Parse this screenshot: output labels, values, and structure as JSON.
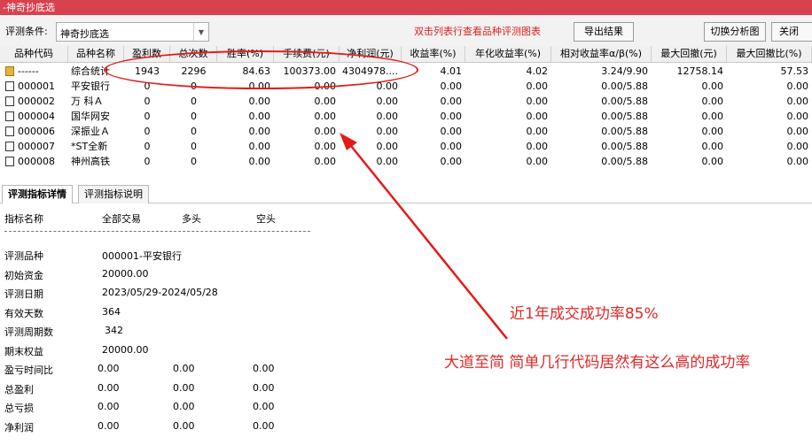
{
  "window": {
    "title": "-神奇抄底选"
  },
  "toolbar": {
    "condition_label": "评测条件:",
    "condition_value": "神奇抄底选",
    "hint": "双击列表行查看品种评测图表",
    "export_button": "导出结果",
    "switch_button": "切换分析图",
    "close_button": "关闭"
  },
  "table": {
    "columns": [
      "品种代码",
      "品种名称",
      "盈利数",
      "总次数",
      "胜率(%)",
      "手续费(元)",
      "净利润(元)",
      "收益率(%)",
      "年化收益率(%)",
      "相对收益率α/β(%)",
      "最大回撤(元)",
      "最大回撤比(%)"
    ],
    "rows": [
      [
        "------",
        "综合统计",
        "1943",
        "2296",
        "84.63",
        "100373.00",
        "4304978....",
        "4.01",
        "4.02",
        "3.24/9.90",
        "12758.14",
        "57.53"
      ],
      [
        "000001",
        "平安银行",
        "0",
        "0",
        "0.00",
        "0.00",
        "0.00",
        "0.00",
        "0.00",
        "0.00/5.88",
        "0.00",
        "0.00"
      ],
      [
        "000002",
        "万 科Ａ",
        "0",
        "0",
        "0.00",
        "0.00",
        "0.00",
        "0.00",
        "0.00",
        "0.00/5.88",
        "0.00",
        "0.00"
      ],
      [
        "000004",
        "国华网安",
        "0",
        "0",
        "0.00",
        "0.00",
        "0.00",
        "0.00",
        "0.00",
        "0.00/5.88",
        "0.00",
        "0.00"
      ],
      [
        "000006",
        "深振业Ａ",
        "0",
        "0",
        "0.00",
        "0.00",
        "0.00",
        "0.00",
        "0.00",
        "0.00/5.88",
        "0.00",
        "0.00"
      ],
      [
        "000007",
        "*ST全新",
        "0",
        "0",
        "0.00",
        "0.00",
        "0.00",
        "0.00",
        "0.00",
        "0.00/5.88",
        "0.00",
        "0.00"
      ],
      [
        "000008",
        "神州高铁",
        "0",
        "0",
        "0.00",
        "0.00",
        "0.00",
        "0.00",
        "0.00",
        "0.00/5.88",
        "0.00",
        "0.00"
      ]
    ]
  },
  "tabs": [
    "评测指标详情",
    "评测指标说明"
  ],
  "detail": {
    "headers": [
      "指标名称",
      "全部交易",
      "多头",
      "空头"
    ],
    "rows": [
      [
        "评测品种",
        "000001-平安银行"
      ],
      [
        "初始资金",
        "20000.00"
      ],
      [
        "评测日期",
        "2023/05/29-2024/05/28"
      ],
      [
        "有效天数",
        "364"
      ],
      [
        "评测周期数",
        "342"
      ],
      [
        "期末权益",
        "20000.00"
      ],
      [
        "盈亏时间比",
        "0.00",
        "0.00",
        "0.00"
      ],
      [
        "总盈利",
        "0.00",
        "0.00",
        "0.00"
      ],
      [
        "总亏损",
        "0.00",
        "0.00",
        "0.00"
      ],
      [
        "净利润",
        "0.00",
        "0.00",
        "0.00"
      ]
    ]
  },
  "annotations": {
    "line1": "近1年成交成功率85%",
    "line2": "大道至简 简单几行代码居然有这么高的成功率",
    "color": "#e02828"
  }
}
